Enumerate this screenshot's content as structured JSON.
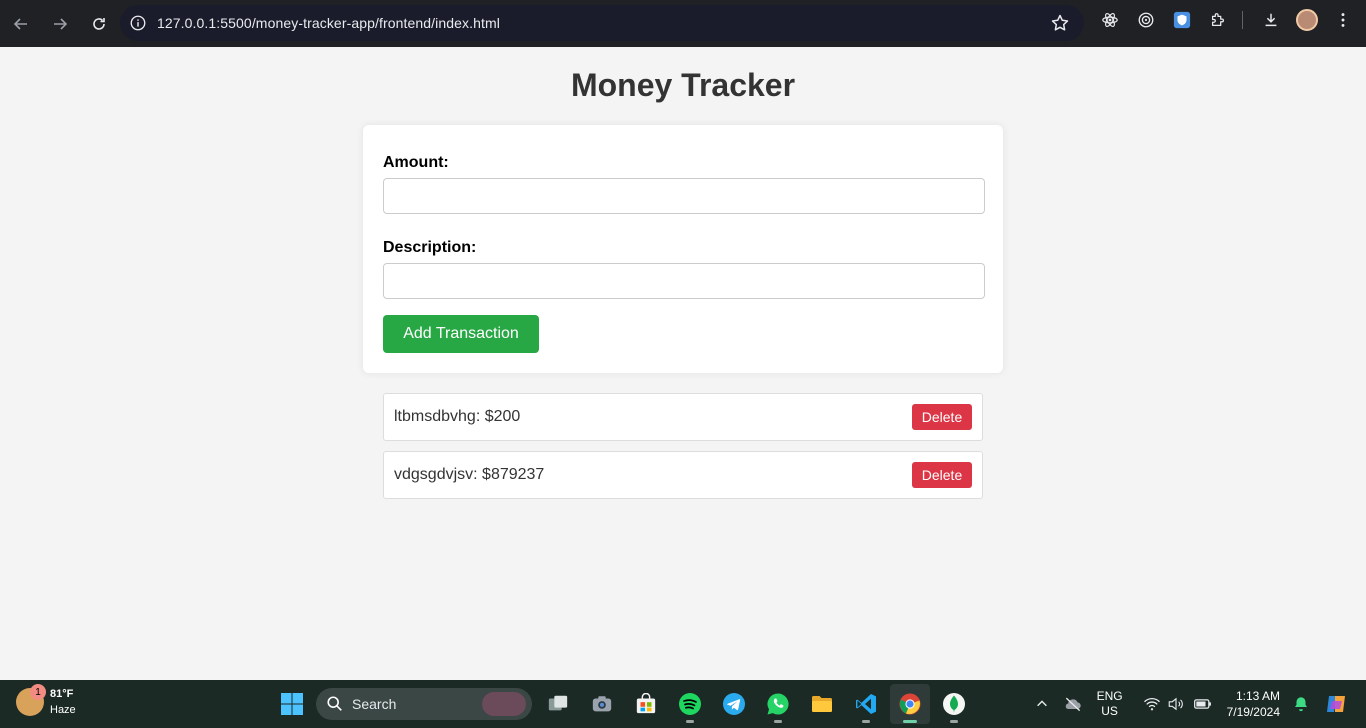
{
  "browser": {
    "url": "127.0.0.1:5500/money-tracker-app/frontend/index.html"
  },
  "page": {
    "title": "Money Tracker",
    "form": {
      "amount_label": "Amount:",
      "amount_value": "",
      "description_label": "Description:",
      "description_value": "",
      "submit_label": "Add Transaction"
    },
    "transactions": [
      {
        "text": "ltbmsdbvhg: $200",
        "delete_label": "Delete"
      },
      {
        "text": "vdgsgdvjsv: $879237",
        "delete_label": "Delete"
      }
    ]
  },
  "taskbar": {
    "weather": {
      "temp": "81°F",
      "condition": "Haze",
      "badge": "1"
    },
    "search_placeholder": "Search",
    "apps": [
      "start-icon",
      "search",
      "task-view-icon",
      "camera-icon",
      "store-icon",
      "spotify-icon",
      "telegram-icon",
      "whatsapp-icon",
      "file-explorer-icon",
      "vscode-icon",
      "chrome-icon",
      "mongodb-compass-icon"
    ],
    "language": {
      "line1": "ENG",
      "line2": "US"
    },
    "clock": {
      "time": "1:13 AM",
      "date": "7/19/2024"
    }
  },
  "colors": {
    "add_button": "#28a745",
    "delete_button": "#dc3545",
    "page_bg": "#f4f4f4"
  }
}
